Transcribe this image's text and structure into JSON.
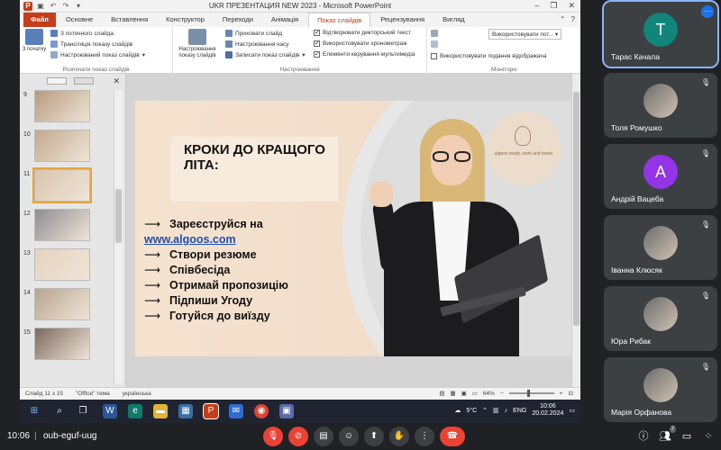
{
  "window": {
    "title": "UKR ПРЕЗЕНТАЦИЯ NEW 2023 - Microsoft PowerPoint"
  },
  "ribbon": {
    "tabs": [
      {
        "label": "Файл",
        "kind": "file"
      },
      {
        "label": "Основне"
      },
      {
        "label": "Вставлення"
      },
      {
        "label": "Конструктор"
      },
      {
        "label": "Переходи"
      },
      {
        "label": "Анімація"
      },
      {
        "label": "Показ слайдів",
        "active": true
      },
      {
        "label": "Рецензування"
      },
      {
        "label": "Вигляд"
      }
    ],
    "start_group": {
      "big_label": "З початку",
      "from_current": "З поточного слайда",
      "broadcast": "Трансляція показу слайдів",
      "custom_show": "Настроюваний показ слайдів",
      "group_label": "Розпочати показ слайдів"
    },
    "setup_group": {
      "setup_show": "Настроювання показу слайдів",
      "hide_slide": "Приховати слайд",
      "rehearse": "Настроювання часу",
      "record": "Записати показ слайдів",
      "play_narrations": "Відтворювати дикторський текст",
      "use_timings": "Використовувати хронометраж",
      "show_controls": "Елементи керування мультимедіа",
      "group_label": "Настроювання"
    },
    "monitors_group": {
      "use_dropdown": "Використовувати пот...",
      "presenter_view": "Використовувати подання відображача",
      "group_label": "Монітори"
    }
  },
  "thumbnails": [
    {
      "num": "9",
      "color": "#b79c7e"
    },
    {
      "num": "10",
      "color": "#c3a98c"
    },
    {
      "num": "11",
      "color": "#d9c4ad",
      "selected": true
    },
    {
      "num": "12",
      "color": "#8f8d90"
    },
    {
      "num": "13",
      "color": "#e6d3bf"
    },
    {
      "num": "14",
      "color": "#b8a48f"
    },
    {
      "num": "15",
      "color": "#7c6a5c"
    }
  ],
  "slide": {
    "headline": "КРОКИ ДО КРАЩОГО ЛІТА:",
    "steps": [
      {
        "arrow": "⟶",
        "text": "Зареєструйся на"
      },
      {
        "arrow": "",
        "text": "www.algoos.com",
        "link": true
      },
      {
        "arrow": "⟶",
        "text": "Створи резюме"
      },
      {
        "arrow": "⟶",
        "text": "Співбесіда"
      },
      {
        "arrow": "⟶",
        "text": "Отримай пропозицію"
      },
      {
        "arrow": "⟶",
        "text": "Підпиши Угоду"
      },
      {
        "arrow": "⟶",
        "text": "Готуйся до виїзду"
      }
    ],
    "logo_text": "algoos study, work and travel"
  },
  "statusbar": {
    "slide_count": "Слайд 11 з 15",
    "theme": "\"Office\" тема",
    "language": "українська",
    "zoom": "64%"
  },
  "taskbar": {
    "weather": "5°C",
    "lang": "ENG",
    "time": "10:06",
    "date": "20.02.2024"
  },
  "participants": [
    {
      "name": "Тарас Качала",
      "initial": "T",
      "color": "#12857a",
      "active": true,
      "more": "⋯"
    },
    {
      "name": "Толя Ромушко",
      "photo": true
    },
    {
      "name": "Андрій Вацеба",
      "initial": "A",
      "color": "#9334e6"
    },
    {
      "name": "Іванна Клюсяк",
      "photo": true
    },
    {
      "name": "Юра Рибак",
      "photo": true
    },
    {
      "name": "Марія Орфанова",
      "photo": true
    }
  ],
  "meet": {
    "time": "10:06",
    "separator": "|",
    "code": "oub-eguf-uug",
    "people_count": "7"
  }
}
